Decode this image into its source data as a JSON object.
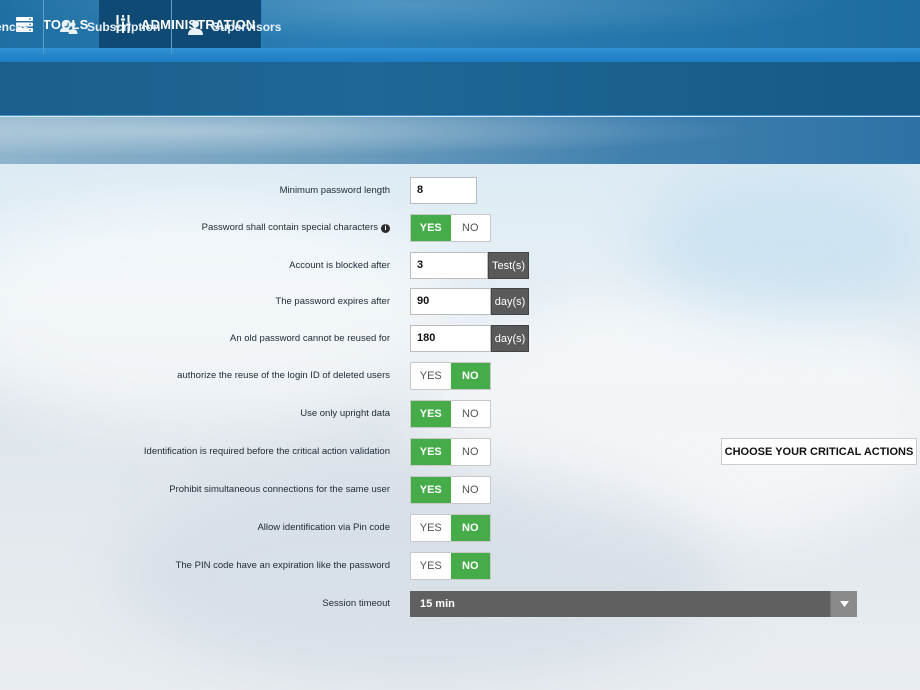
{
  "topnav": {
    "tools_label": "TOOLS",
    "admin_label": "ADMINISTRATION"
  },
  "subnav": {
    "preferences_label": "ences",
    "subscription_label": "Subscription",
    "supervisors_label": "Supervisors"
  },
  "form": {
    "min_password_length": {
      "label": "Minimum password length",
      "value": "8"
    },
    "special_chars": {
      "label": "Password shall contain special characters",
      "yes": "YES",
      "no": "NO",
      "selected": "YES"
    },
    "account_blocked": {
      "label": "Account is blocked after",
      "value": "3",
      "unit": "Test(s)"
    },
    "password_expires": {
      "label": "The password expires after",
      "value": "90",
      "unit": "day(s)"
    },
    "old_password_reuse": {
      "label": "An old password cannot be reused for",
      "value": "180",
      "unit": "day(s)"
    },
    "reuse_login_id": {
      "label": "authorize the reuse of the login ID of deleted users",
      "yes": "YES",
      "no": "NO",
      "selected": "NO"
    },
    "upright_data": {
      "label": "Use only upright data",
      "yes": "YES",
      "no": "NO",
      "selected": "YES"
    },
    "critical_identification": {
      "label": "Identification is required before the critical action validation",
      "yes": "YES",
      "no": "NO",
      "selected": "YES"
    },
    "prohibit_simultaneous": {
      "label": "Prohibit simultaneous connections for the same user",
      "yes": "YES",
      "no": "NO",
      "selected": "YES"
    },
    "pin_identification": {
      "label": "Allow identification via Pin code",
      "yes": "YES",
      "no": "NO",
      "selected": "NO"
    },
    "pin_expiration": {
      "label": "The PIN code have an expiration like the password",
      "yes": "YES",
      "no": "NO",
      "selected": "NO"
    },
    "session_timeout": {
      "label": "Session timeout",
      "value": "15 min"
    },
    "choose_critical_label": "CHOOSE YOUR CRITICAL ACTIONS"
  },
  "colors": {
    "toggle_on": "#46ac49",
    "addon_bg": "#5a5a5a",
    "active_tab": "#0f4a74"
  }
}
